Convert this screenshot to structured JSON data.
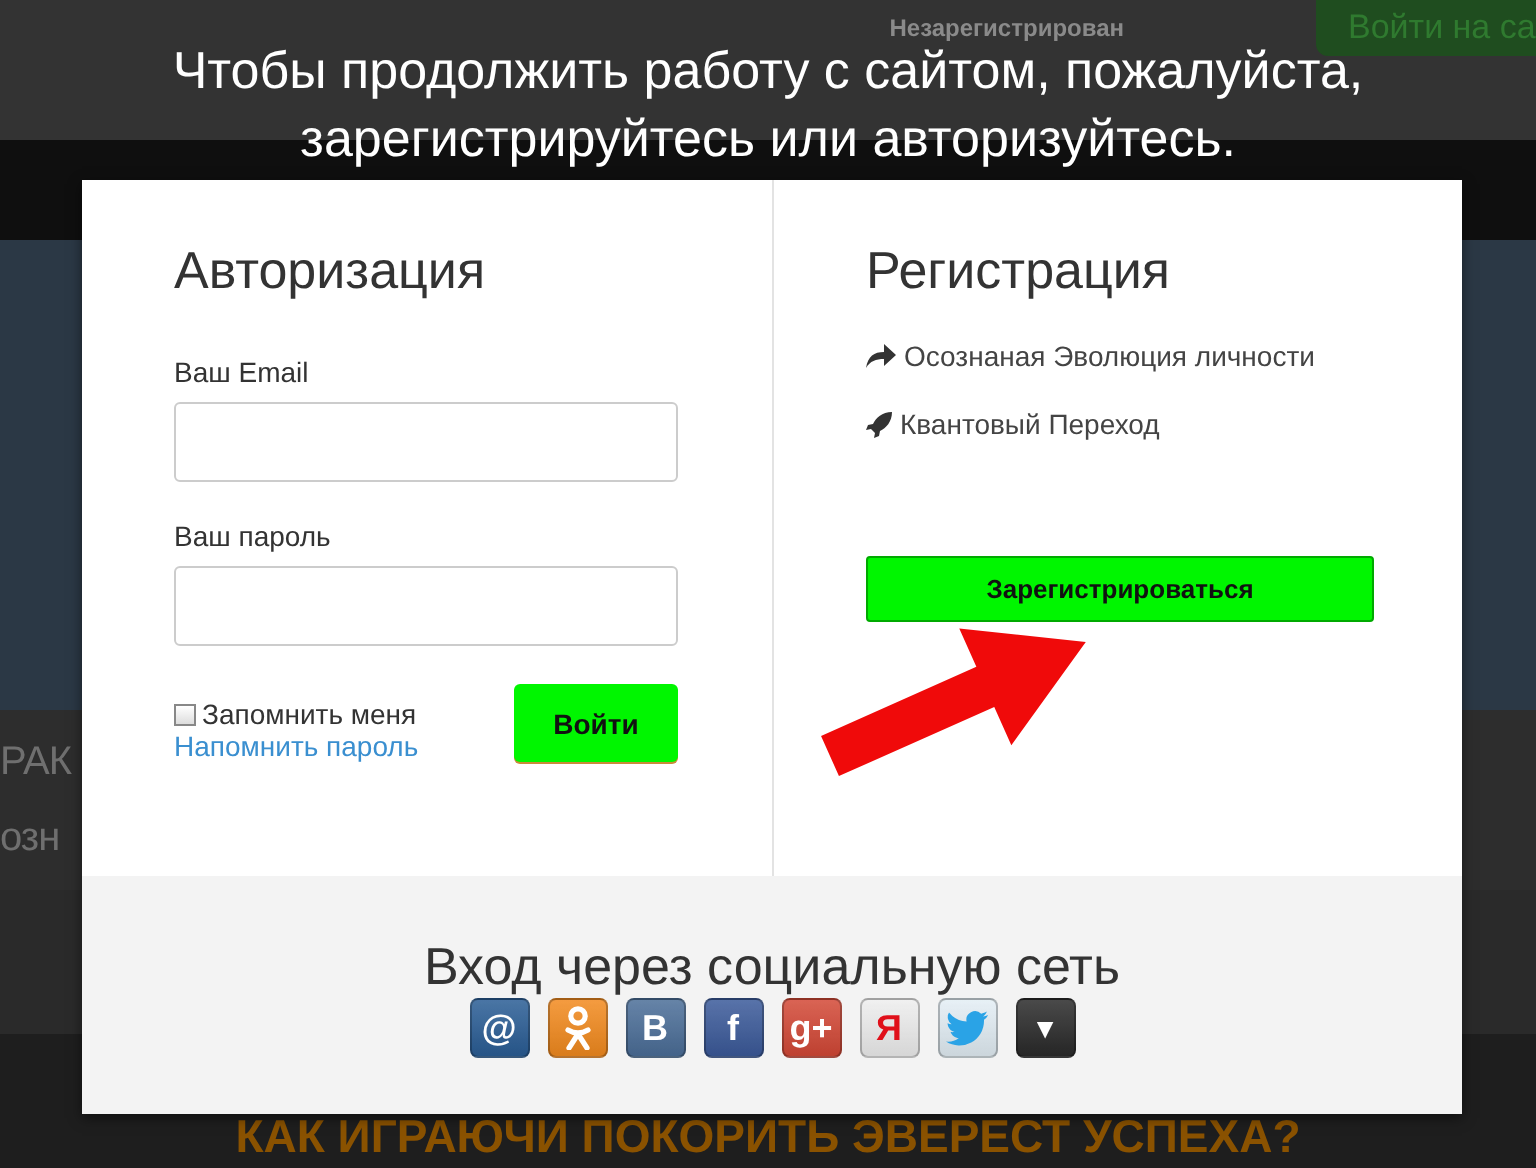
{
  "background_page": {
    "user_status": "Незарегистрирован",
    "login_button": "Войти на са",
    "side_text": [
      "РАК",
      "озн"
    ],
    "bottom_heading": "КАК ИГРАЮЧИ ПОКОРИТЬ ЭВЕРЕСТ УСПЕХА?"
  },
  "message_lines": [
    "Чтобы продолжить работу с сайтом, пожалуйста,",
    "зарегистрируйтесь или авторизуйтесь."
  ],
  "login": {
    "title": "Авторизация",
    "fields": [
      {
        "label": "Ваш Email"
      },
      {
        "label": "Ваш пароль"
      }
    ],
    "remember": {
      "label": "Запомнить меня",
      "checked": false
    },
    "forgot_link": "Напомнить пароль",
    "submit": "Войти"
  },
  "registration": {
    "title": "Регистрация",
    "items": [
      {
        "kind": "share",
        "label": "Осознаная Эволюция личности"
      },
      {
        "kind": "rocket",
        "label": "Квантовый Переход"
      }
    ],
    "button": "Зарегистрироваться"
  },
  "social": {
    "title": "Вход через социальную сеть",
    "networks": [
      {
        "kind": "glyph",
        "glyph": "@",
        "color": "#2a5d95"
      },
      {
        "kind": "figure",
        "color": "#f28a1e"
      },
      {
        "kind": "glyph",
        "glyph": "B",
        "color": "#4b6e98"
      },
      {
        "kind": "glyph",
        "glyph": "f",
        "color": "#3b5a9a"
      },
      {
        "kind": "glyph",
        "glyph": "g+",
        "color": "#d34836"
      },
      {
        "kind": "glyph",
        "glyph": "Я",
        "color": "#eeeeee"
      },
      {
        "kind": "bird",
        "color": "#e3eef5"
      },
      {
        "kind": "glyph",
        "glyph": "▼",
        "color": "#2a2a2a"
      }
    ]
  }
}
